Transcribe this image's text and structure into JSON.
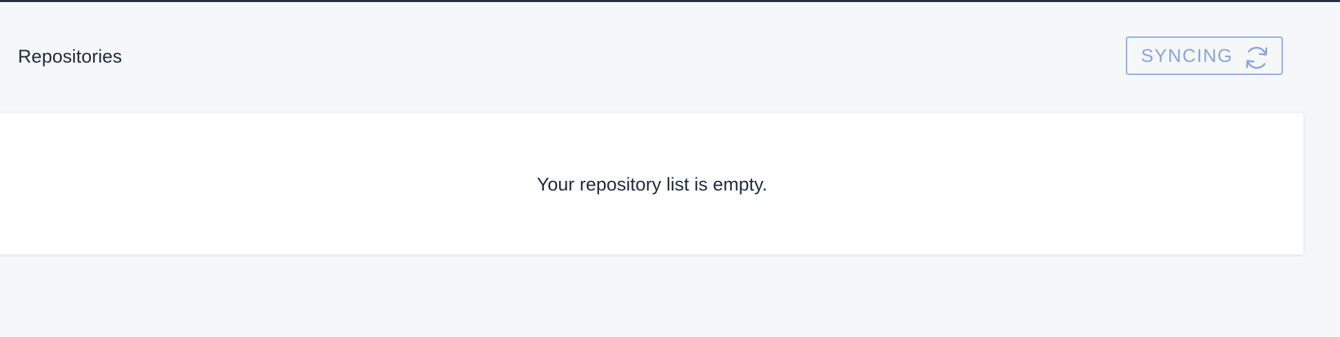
{
  "header": {
    "title": "Repositories",
    "sync_button": {
      "label": "SYNCING",
      "icon": "sync-icon",
      "color": "#86a6da"
    }
  },
  "main": {
    "empty_message": "Your repository list is empty."
  },
  "colors": {
    "background": "#f6f7f9",
    "top_border": "#22303f",
    "text": "#1c2b3f",
    "card": "#ffffff"
  }
}
